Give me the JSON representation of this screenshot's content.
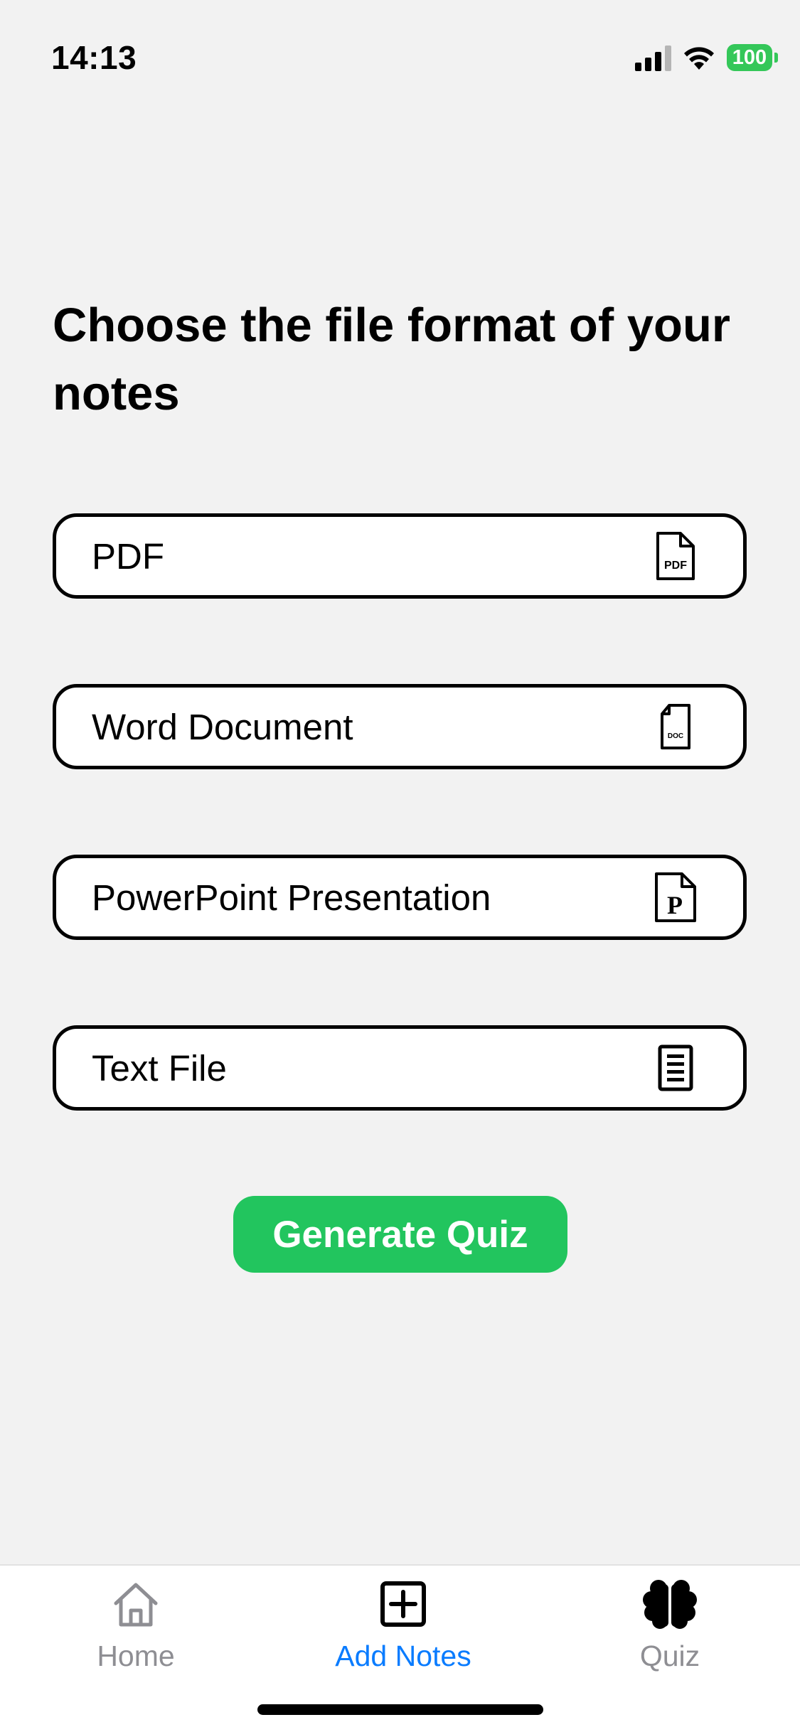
{
  "status_bar": {
    "time": "14:13",
    "battery_level": "100",
    "signal_icon": "cellular-signal-icon",
    "wifi_icon": "wifi-icon",
    "battery_color": "#34c759"
  },
  "main": {
    "title": "Choose the file format of your notes",
    "options": [
      {
        "label": "PDF",
        "icon": "pdf-file-icon",
        "icon_text": "PDF"
      },
      {
        "label": "Word Document",
        "icon": "doc-file-icon",
        "icon_text": "DOC"
      },
      {
        "label": "PowerPoint Presentation",
        "icon": "powerpoint-file-icon",
        "icon_text": "P"
      },
      {
        "label": "Text File",
        "icon": "text-file-icon"
      }
    ],
    "generate_button": {
      "label": "Generate Quiz",
      "color": "#22c55e"
    }
  },
  "tab_bar": {
    "tabs": [
      {
        "label": "Home",
        "icon": "house-icon",
        "active": false
      },
      {
        "label": "Add Notes",
        "icon": "plus-square-icon",
        "active": true
      },
      {
        "label": "Quiz",
        "icon": "brain-icon",
        "active": false
      }
    ],
    "active_color": "#0a7cff",
    "inactive_color": "#8e8e93"
  }
}
